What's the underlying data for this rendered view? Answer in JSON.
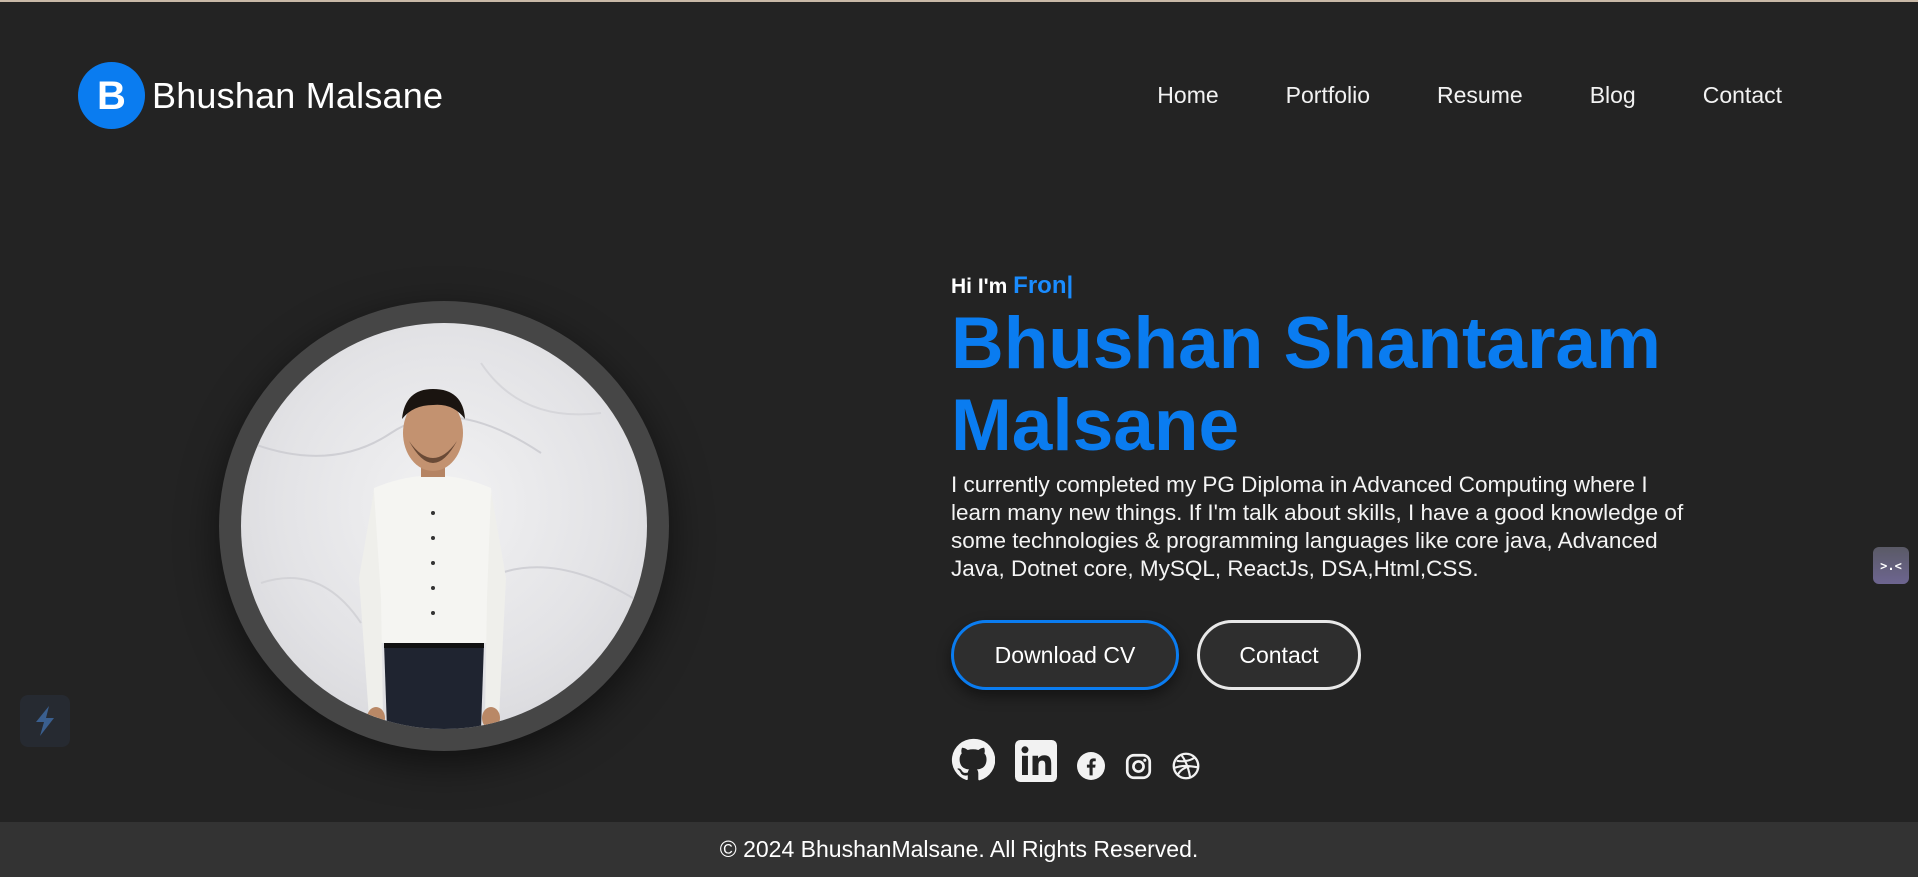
{
  "brand": {
    "logo_letter": "B",
    "name": "Bhushan Malsane"
  },
  "nav": {
    "items": [
      {
        "label": "Home"
      },
      {
        "label": "Portfolio"
      },
      {
        "label": "Resume"
      },
      {
        "label": "Blog"
      },
      {
        "label": "Contact"
      }
    ]
  },
  "hero": {
    "greeting_prefix": "Hi I'm ",
    "typed_role": "Fron|",
    "name_line1": "Bhushan Shantaram",
    "name_line2": "Malsane",
    "bio": "I currently completed my PG Diploma in Advanced Computing where I learn many new things. If I'm talk about skills, I have a good knowledge of some technologies & programming languages like core java, Advanced Java, Dotnet core, MySQL, ReactJs, DSA,Html,CSS.",
    "download_cv_label": "Download CV",
    "contact_label": "Contact"
  },
  "socials": [
    "github-icon",
    "linkedin-icon",
    "facebook-icon",
    "instagram-icon",
    "dribbble-icon"
  ],
  "widgets": {
    "right_badge_text": ">.<"
  },
  "footer": {
    "copyright": "© 2024 BhushanMalsane. All Rights Reserved."
  },
  "colors": {
    "accent": "#0a7cf0",
    "background": "#232323",
    "footer_bg": "#333333"
  }
}
